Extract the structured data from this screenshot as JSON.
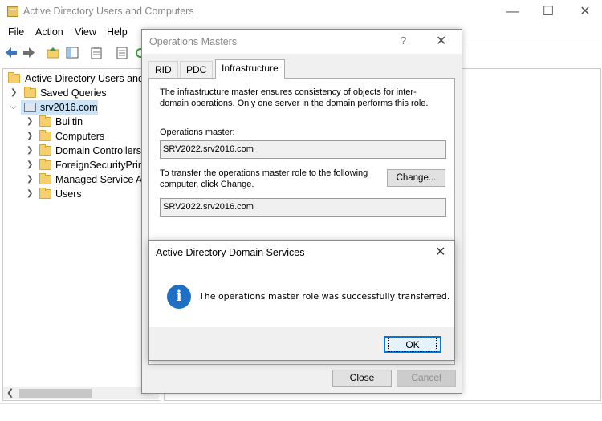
{
  "main_window": {
    "title": "Active Directory Users and Computers",
    "controls": [
      "—",
      "☐",
      "✕"
    ]
  },
  "menu": [
    "File",
    "Action",
    "View",
    "Help"
  ],
  "tree": {
    "root": "Active Directory Users and C",
    "saved_queries": "Saved Queries",
    "domain": "srv2016.com",
    "children": [
      "Builtin",
      "Computers",
      "Domain Controllers",
      "ForeignSecurityPrinc",
      "Managed Service Ac",
      "Users"
    ]
  },
  "om_dialog": {
    "title": "Operations Masters",
    "help": "?",
    "close": "✕",
    "tabs": [
      "RID",
      "PDC",
      "Infrastructure"
    ],
    "active_tab": "Infrastructure",
    "description": "The infrastructure master ensures consistency of objects for inter-domain operations. Only one server in the domain performs this role.",
    "ops_master_label": "Operations master:",
    "ops_master_value": "SRV2022.srv2016.com",
    "transfer_label": "To transfer the operations master role to the following computer, click Change.",
    "change_button": "Change...",
    "target_value": "SRV2022.srv2016.com",
    "close_button": "Close",
    "cancel_button": "Cancel"
  },
  "message_box": {
    "title": "Active Directory Domain Services",
    "close": "✕",
    "icon": "i",
    "text": "The operations master role was successfully transferred.",
    "ok_button": "OK"
  },
  "colors": {
    "accent": "#0078d7",
    "info_icon": "#1f6fc4",
    "selection": "#cce4f7",
    "folder": "#f4cf6b"
  }
}
